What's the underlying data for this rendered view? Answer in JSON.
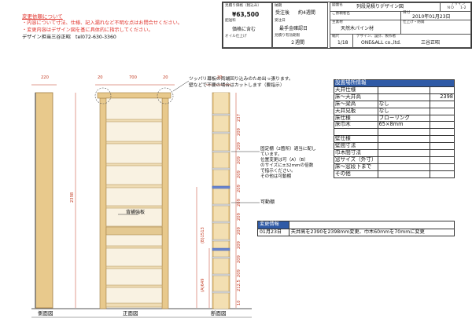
{
  "notes": {
    "title": "変更依頼について",
    "lines": [
      "・内容について寸法、仕様、記入漏れなど不明な点はお問合せください。",
      "・変更内容はデザイン図を基に具体的に指示してください。"
    ],
    "designer": "デザイン担当三谷正昭　tel072-630-3360"
  },
  "quote": {
    "price_label": "見積り価格（税込み）",
    "price": "¥63,500",
    "shipping_label": "配送料",
    "shipping": "価格に含む",
    "oil_label": "オイル仕上げ"
  },
  "delivery": {
    "label": "納期",
    "order_label": "受注後",
    "order_value": "約4週間",
    "ordered_label": "受注日",
    "confirm_label": "最手金確認日",
    "deadline_label": "見積り有効期限",
    "deadline_value": "２週間"
  },
  "drawing": {
    "name_label": "図面名",
    "name": "列段見積りデザイン図",
    "customer_label": "ご依頼者名",
    "date_label": "日付",
    "date": "2010年01月23日",
    "material_label": "主素材",
    "material": "天然木パイン材",
    "finish_label": "仕上げ・防腐",
    "scale_label": "縮尺",
    "scale": "1/18",
    "maker_label": "デザイン、設計、製作者",
    "maker": "ONE&ALL co.,ltd.",
    "designer": "三谷正昭",
    "design_label": "デザイン",
    "design_no_label": "ＮＯ",
    "design_no": "1-2"
  },
  "spec": {
    "header": "設置場所情報",
    "rows": [
      {
        "label": "天井仕様",
        "value": "",
        "num": ""
      },
      {
        "label": "床～天井高",
        "value": "",
        "num": "2398"
      },
      {
        "label": "床～梁高",
        "value": "なし",
        "num": ""
      },
      {
        "label": "天井見板",
        "value": "なし",
        "num": ""
      },
      {
        "label": "床仕様",
        "value": "フローリング",
        "num": ""
      },
      {
        "label": "床巾木",
        "value": "65×8mm",
        "num": ""
      },
      {
        "label": "",
        "value": "",
        "num": ""
      },
      {
        "label": "壁仕様",
        "value": "",
        "num": ""
      },
      {
        "label": "壁間寸法",
        "value": "",
        "num": ""
      },
      {
        "label": "巾木間寸法",
        "value": "",
        "num": ""
      },
      {
        "label": "窓サイズ（外寸）",
        "value": "",
        "num": ""
      },
      {
        "label": "床～窓段下まで",
        "value": "",
        "num": ""
      },
      {
        "label": "その他",
        "value": "",
        "num": ""
      }
    ]
  },
  "changes": {
    "header": "変更情報",
    "rows": [
      {
        "date": "01月23日",
        "text": "天井高を2390を2398mm変更、巾木60mmを70mmに変更"
      }
    ]
  },
  "annotations": {
    "top_note": "ツッパリ幕板の両端回り込みのため出っ張ります。\n壁などで不要の場合はカットします（要指示）",
    "fixed_shelf": "固定棚（2箇所）適当に配し\nています。\n位置変更は可（A）（B）\nのサイズに±32mmの倍数\nで指示ください。\nその他は可動棚",
    "movable": "可動棚",
    "back": "背補強板",
    "dim_b": "(B)1513",
    "dim_a": "(A)649",
    "height": "2398"
  },
  "views": {
    "side": "側面図",
    "front": "正面図",
    "section": "断面図"
  },
  "dims": {
    "side_w": "220",
    "left_post": "20",
    "inner": "700",
    "right_post": "20",
    "sec_w": "20"
  },
  "section_marks": [
    "237",
    "209",
    "209",
    "209",
    "209",
    "209",
    "209",
    "209",
    "209",
    "209",
    "209",
    "209",
    "212.5",
    "10"
  ]
}
